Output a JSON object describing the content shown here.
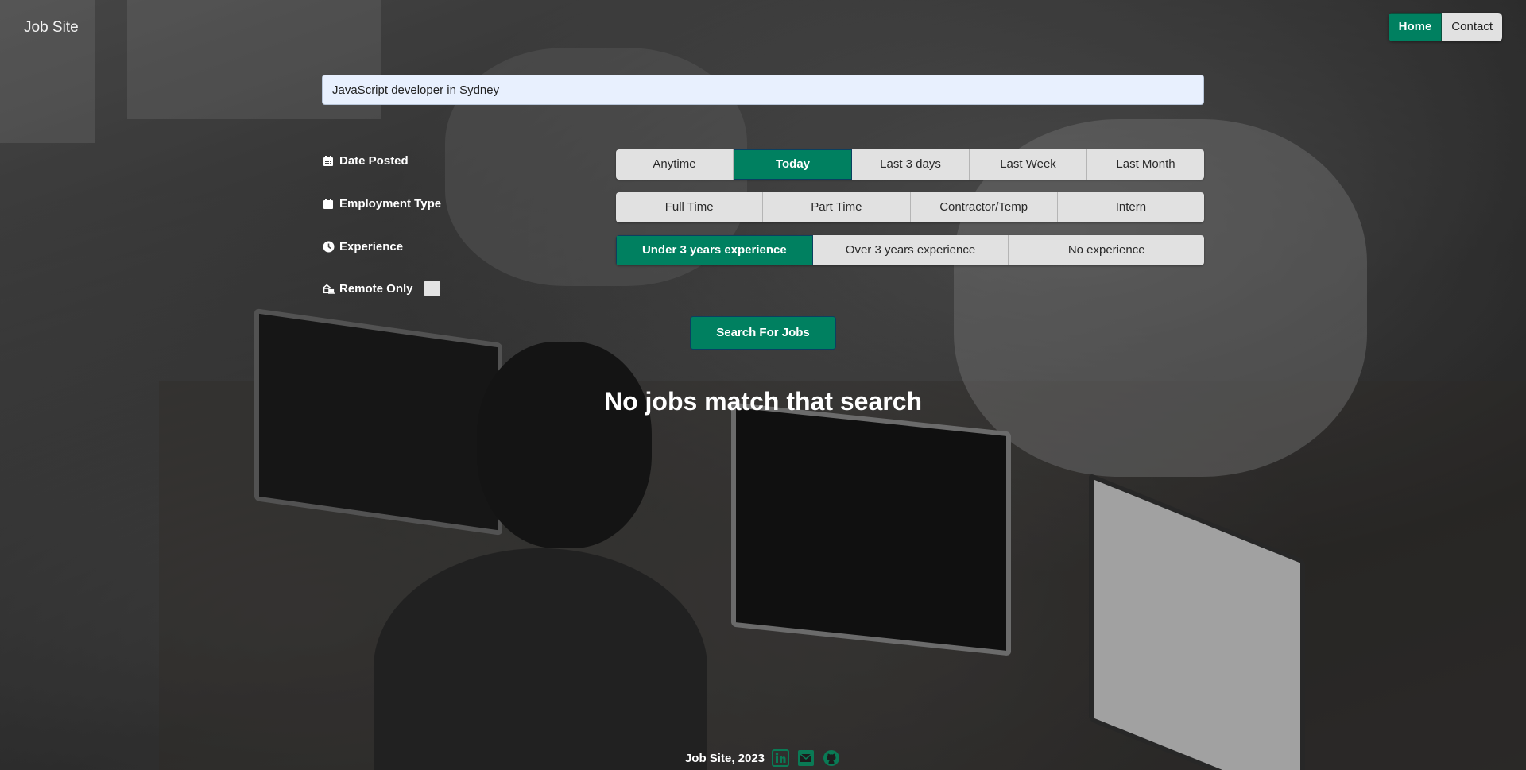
{
  "brand": "Job Site",
  "nav": {
    "items": [
      {
        "label": "Home",
        "active": true
      },
      {
        "label": "Contact",
        "active": false
      }
    ]
  },
  "search": {
    "value": "JavaScript developer in Sydney"
  },
  "filters": {
    "date_posted": {
      "label": "Date Posted",
      "icon": "calendar-icon",
      "options": [
        "Anytime",
        "Today",
        "Last 3 days",
        "Last Week",
        "Last Month"
      ],
      "selected": "Today"
    },
    "employment_type": {
      "label": "Employment Type",
      "icon": "calendar-icon",
      "options": [
        "Full Time",
        "Part Time",
        "Contractor/Temp",
        "Intern"
      ],
      "selected": null
    },
    "experience": {
      "label": "Experience",
      "icon": "clock-icon",
      "options": [
        "Under 3 years experience",
        "Over 3 years experience",
        "No experience"
      ],
      "selected": "Under 3 years experience"
    },
    "remote": {
      "label": "Remote Only",
      "icon": "house-laptop-icon",
      "checked": false
    }
  },
  "search_button": "Search For Jobs",
  "result_message": "No jobs match that search",
  "footer": {
    "text": "Job Site, 2023",
    "icons": [
      "linkedin-icon",
      "email-icon",
      "github-icon"
    ]
  },
  "colors": {
    "accent": "#008060",
    "button_bg": "#e1e1e1",
    "input_bg": "#e8f0fe"
  }
}
